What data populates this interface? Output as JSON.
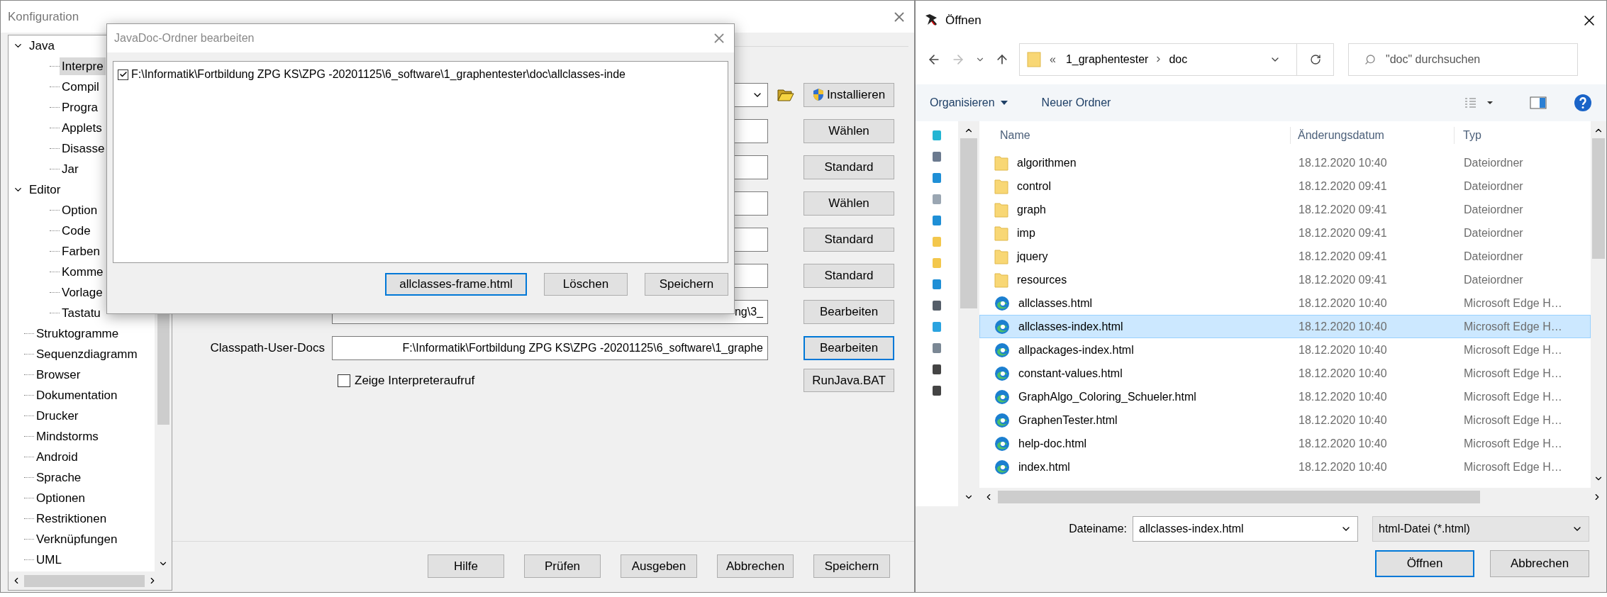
{
  "config": {
    "title": "Konfiguration",
    "tree": [
      {
        "label": "Java",
        "selected": false,
        "expanded": true,
        "children": [
          {
            "label": "Interpre",
            "selected": true
          },
          {
            "label": "Compil",
            "selected": false
          },
          {
            "label": "Progra",
            "selected": false
          },
          {
            "label": "Applets",
            "selected": false
          },
          {
            "label": "Disasse",
            "selected": false
          },
          {
            "label": "Jar",
            "selected": false
          }
        ]
      },
      {
        "label": "Editor",
        "selected": false,
        "expanded": true,
        "children": [
          {
            "label": "Option",
            "selected": false
          },
          {
            "label": "Code",
            "selected": false
          },
          {
            "label": "Farben",
            "selected": false
          },
          {
            "label": "Komme",
            "selected": false
          },
          {
            "label": "Vorlage",
            "selected": false
          },
          {
            "label": "Tastatu",
            "selected": false
          }
        ]
      },
      {
        "label": "Struktogramme",
        "selected": false
      },
      {
        "label": "Sequenzdiagramm",
        "selected": false
      },
      {
        "label": "Browser",
        "selected": false
      },
      {
        "label": "Dokumentation",
        "selected": false
      },
      {
        "label": "Drucker",
        "selected": false
      },
      {
        "label": "Mindstorms",
        "selected": false
      },
      {
        "label": "Android",
        "selected": false
      },
      {
        "label": "Sprache",
        "selected": false
      },
      {
        "label": "Optionen",
        "selected": false
      },
      {
        "label": "Restriktionen",
        "selected": false
      },
      {
        "label": "Verknüpfungen",
        "selected": false
      },
      {
        "label": "UML",
        "selected": false
      }
    ],
    "rows": [
      {
        "kind": "combo",
        "button": {
          "label": "Installieren",
          "focused": false
        }
      },
      {
        "kind": "field",
        "button": {
          "label": "Wählen",
          "focused": false
        }
      },
      {
        "kind": "field",
        "button": {
          "label": "Standard",
          "focused": false
        }
      },
      {
        "kind": "field",
        "button": {
          "label": "Wählen",
          "focused": false
        }
      },
      {
        "kind": "field",
        "button": {
          "label": "Standard",
          "focused": false
        }
      },
      {
        "kind": "field",
        "button": {
          "label": "Standard",
          "focused": false
        }
      },
      {
        "kind": "field",
        "value": "ng\\3_",
        "button": {
          "label": "Bearbeiten",
          "focused": false
        }
      },
      {
        "kind": "field",
        "label": "Classpath-User-Docs",
        "value": "F:\\Informatik\\Fortbildung ZPG KS\\ZPG -20201125\\6_software\\1_graphe",
        "button": {
          "label": "Bearbeiten",
          "focused": true
        }
      }
    ],
    "checkbox": {
      "label": "Zeige Interpreteraufruf",
      "checked": false
    },
    "runjava": "RunJava.BAT",
    "footer": [
      "Hilfe",
      "Prüfen",
      "Ausgeben",
      "Abbrechen",
      "Speichern"
    ]
  },
  "javadoc": {
    "title": "JavaDoc-Ordner bearbeiten",
    "items": [
      {
        "path": "F:\\Informatik\\Fortbildung ZPG KS\\ZPG -20201125\\6_software\\1_graphentester\\doc\\allclasses-inde",
        "checked": true
      }
    ],
    "buttons": [
      {
        "label": "allclasses-frame.html",
        "focused": true
      },
      {
        "label": "Löschen",
        "focused": false
      },
      {
        "label": "Speichern",
        "focused": false
      }
    ]
  },
  "open": {
    "title": "Öffnen",
    "address": {
      "overflow": "«",
      "segments": [
        "1_graphentester",
        "doc"
      ]
    },
    "search": {
      "placeholder": "\"doc\" durchsuchen"
    },
    "toolbar": {
      "organize": "Organisieren",
      "new_folder": "Neuer Ordner"
    },
    "columns": [
      "Name",
      "Änderungsdatum",
      "Typ"
    ],
    "files": [
      {
        "kind": "folder",
        "name": "algorithmen",
        "date": "18.12.2020 10:40",
        "type": "Dateiordner",
        "selected": false
      },
      {
        "kind": "folder",
        "name": "control",
        "date": "18.12.2020 09:41",
        "type": "Dateiordner",
        "selected": false
      },
      {
        "kind": "folder",
        "name": "graph",
        "date": "18.12.2020 09:41",
        "type": "Dateiordner",
        "selected": false
      },
      {
        "kind": "folder",
        "name": "imp",
        "date": "18.12.2020 09:41",
        "type": "Dateiordner",
        "selected": false
      },
      {
        "kind": "folder",
        "name": "jquery",
        "date": "18.12.2020 09:41",
        "type": "Dateiordner",
        "selected": false
      },
      {
        "kind": "folder",
        "name": "resources",
        "date": "18.12.2020 09:41",
        "type": "Dateiordner",
        "selected": false
      },
      {
        "kind": "html",
        "name": "allclasses.html",
        "date": "18.12.2020 10:40",
        "type": "Microsoft Edge H…",
        "selected": false
      },
      {
        "kind": "html",
        "name": "allclasses-index.html",
        "date": "18.12.2020 10:40",
        "type": "Microsoft Edge H…",
        "selected": true
      },
      {
        "kind": "html",
        "name": "allpackages-index.html",
        "date": "18.12.2020 10:40",
        "type": "Microsoft Edge H…",
        "selected": false
      },
      {
        "kind": "html",
        "name": "constant-values.html",
        "date": "18.12.2020 10:40",
        "type": "Microsoft Edge H…",
        "selected": false
      },
      {
        "kind": "html",
        "name": "GraphAlgo_Coloring_Schueler.html",
        "date": "18.12.2020 10:40",
        "type": "Microsoft Edge H…",
        "selected": false
      },
      {
        "kind": "html",
        "name": "GraphenTester.html",
        "date": "18.12.2020 10:40",
        "type": "Microsoft Edge H…",
        "selected": false
      },
      {
        "kind": "html",
        "name": "help-doc.html",
        "date": "18.12.2020 10:40",
        "type": "Microsoft Edge H…",
        "selected": false
      },
      {
        "kind": "html",
        "name": "index.html",
        "date": "18.12.2020 10:40",
        "type": "Microsoft Edge H…",
        "selected": false
      }
    ],
    "filename": {
      "label": "Dateiname:",
      "value": "allclasses-index.html"
    },
    "filetype": "html-Datei (*.html)",
    "buttons": [
      {
        "label": "Öffnen",
        "focused": true
      },
      {
        "label": "Abbrechen",
        "focused": false
      }
    ]
  }
}
